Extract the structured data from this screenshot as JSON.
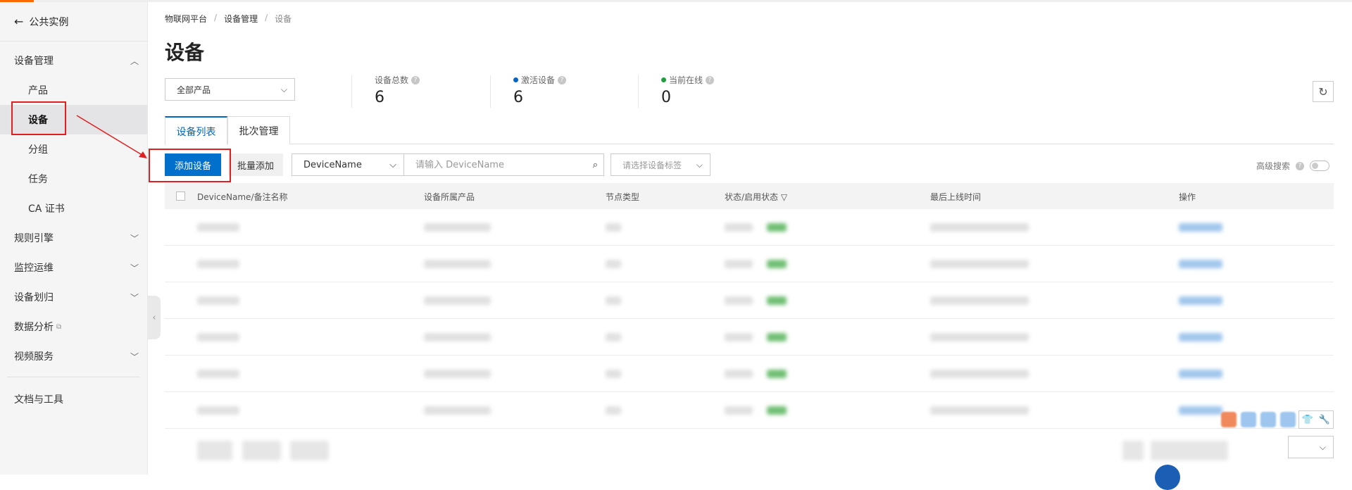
{
  "sidebar": {
    "back_label": "公共实例",
    "groups": [
      {
        "label": "设备管理",
        "expanded": true,
        "items": [
          {
            "label": "产品",
            "active": false
          },
          {
            "label": "设备",
            "active": true
          },
          {
            "label": "分组",
            "active": false
          },
          {
            "label": "任务",
            "active": false
          },
          {
            "label": "CA 证书",
            "active": false
          }
        ]
      },
      {
        "label": "规则引擎",
        "expanded": false
      },
      {
        "label": "监控运维",
        "expanded": false
      },
      {
        "label": "设备划归",
        "expanded": false
      },
      {
        "label": "数据分析",
        "external": true
      },
      {
        "label": "视频服务",
        "expanded": false
      }
    ],
    "footer_item": "文档与工具"
  },
  "breadcrumb": [
    "物联网平台",
    "设备管理",
    "设备"
  ],
  "page_title": "设备",
  "product_filter": {
    "selected": "全部产品"
  },
  "stats": [
    {
      "label": "设备总数",
      "value": "6",
      "dot_color": null
    },
    {
      "label": "激活设备",
      "value": "6",
      "dot_color": "#0064c8"
    },
    {
      "label": "当前在线",
      "value": "0",
      "dot_color": "#1e9e3e"
    }
  ],
  "tabs": [
    {
      "label": "设备列表",
      "active": true
    },
    {
      "label": "批次管理",
      "active": false
    }
  ],
  "toolbar": {
    "add_device": "添加设备",
    "batch_add": "批量添加",
    "search_field": "DeviceName",
    "search_placeholder": "请输入 DeviceName",
    "tag_placeholder": "请选择设备标签",
    "advanced_search": "高级搜索"
  },
  "table": {
    "columns": [
      "DeviceName/备注名称",
      "设备所属产品",
      "节点类型",
      "状态/启用状态",
      "最后上线时间",
      "操作"
    ],
    "row_count": 6
  },
  "colors": {
    "primary": "#0070cc",
    "highlight": "#e02020",
    "brand_accent": "#ff6a00"
  }
}
